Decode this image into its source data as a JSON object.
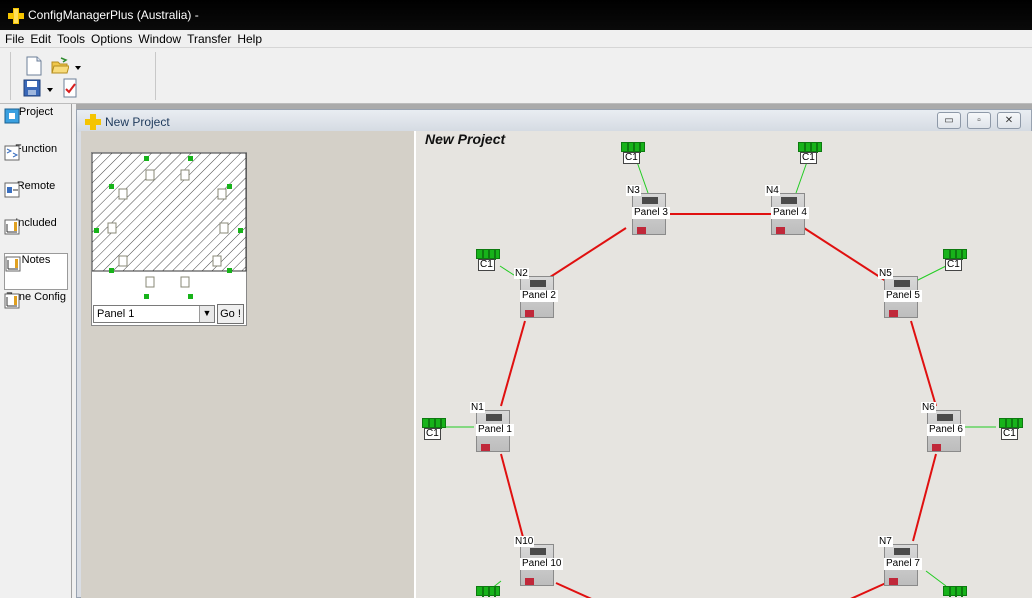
{
  "window": {
    "title": "ConfigManagerPlus (Australia) -"
  },
  "menu": [
    "File",
    "Edit",
    "Tools",
    "Options",
    "Window",
    "Transfer",
    "Help"
  ],
  "toolbar": {
    "icons": [
      "new-file-icon",
      "open-folder-icon",
      "dropdown-arrow-icon",
      "save-icon",
      "dropdown-arrow-icon",
      "check-document-icon"
    ]
  },
  "nav": {
    "items": [
      {
        "label": "Project",
        "icon": "project-icon"
      },
      {
        "label": "Function",
        "icon": "function-icon"
      },
      {
        "label": "Remote",
        "icon": "remote-icon"
      },
      {
        "label": "Included",
        "icon": "included-icon"
      },
      {
        "label": "Notes",
        "icon": "notes-icon",
        "selected": true
      },
      {
        "label": "Zone Config",
        "icon": "zone-config-icon"
      }
    ]
  },
  "child_window": {
    "title": "New Project",
    "buttons": {
      "minimize": "▭",
      "restore": "▫",
      "close": "✕"
    }
  },
  "overview": {
    "panel_select_value": "Panel 1",
    "go_label": "Go !"
  },
  "canvas": {
    "title": "New Project",
    "nodes": [
      {
        "id": "N1",
        "panel": "Panel 1"
      },
      {
        "id": "N2",
        "panel": "Panel 2"
      },
      {
        "id": "N3",
        "panel": "Panel 3"
      },
      {
        "id": "N4",
        "panel": "Panel 4"
      },
      {
        "id": "N5",
        "panel": "Panel 5"
      },
      {
        "id": "N6",
        "panel": "Panel 6"
      },
      {
        "id": "N7",
        "panel": "Panel 7"
      },
      {
        "id": "N10",
        "panel": "Panel 10"
      }
    ],
    "connector_label": "C1"
  },
  "colors": {
    "loop_line": "#e01010",
    "connector_line": "#22cc22",
    "connector_green": "#17b31a"
  }
}
